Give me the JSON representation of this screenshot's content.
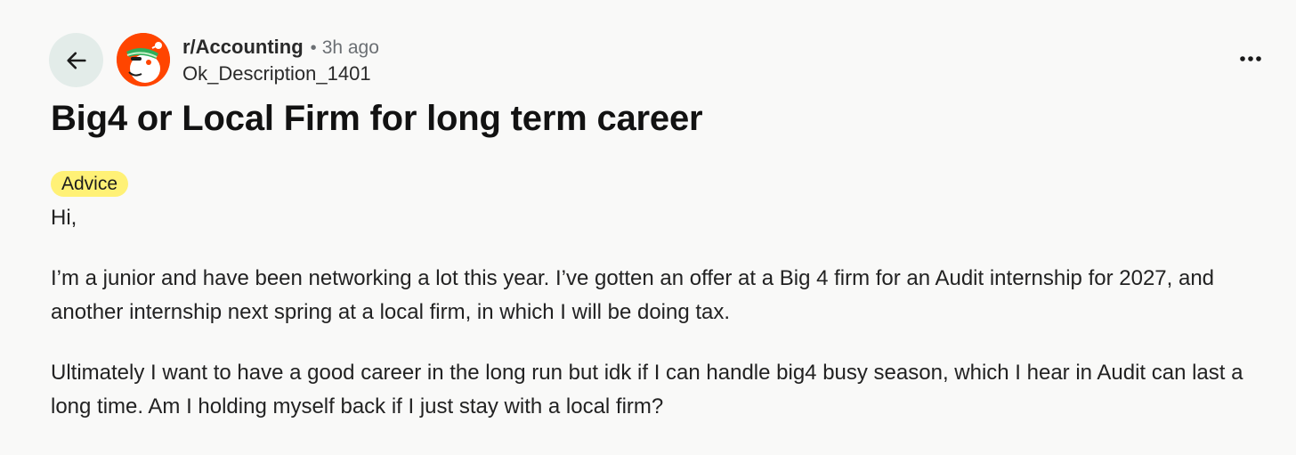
{
  "header": {
    "back_icon": "arrow-left-icon",
    "avatar_icon": "snoo-avatar-icon",
    "subreddit": "r/Accounting",
    "separator": "•",
    "time_ago": "3h ago",
    "username": "Ok_Description_1401",
    "more_icon": "more-horizontal-icon"
  },
  "post": {
    "title": "Big4 or Local Firm for long term career",
    "flair": "Advice",
    "paragraphs": [
      "Hi,",
      "I’m a junior and have been networking a lot this year. I’ve gotten an offer at a Big 4 firm for an Audit internship for 2027, and another internship next spring at a local firm, in which I will be doing tax.",
      "Ultimately I want to have a good career in the long run but idk if I can handle big4 busy season, which I hear in Audit can last a long time. Am I holding myself back if I just stay with a local firm?"
    ]
  },
  "colors": {
    "background": "#f9f9f8",
    "back_button_bg": "#e3ece9",
    "avatar_bg": "#ff4500",
    "flair_bg": "#fff176"
  }
}
